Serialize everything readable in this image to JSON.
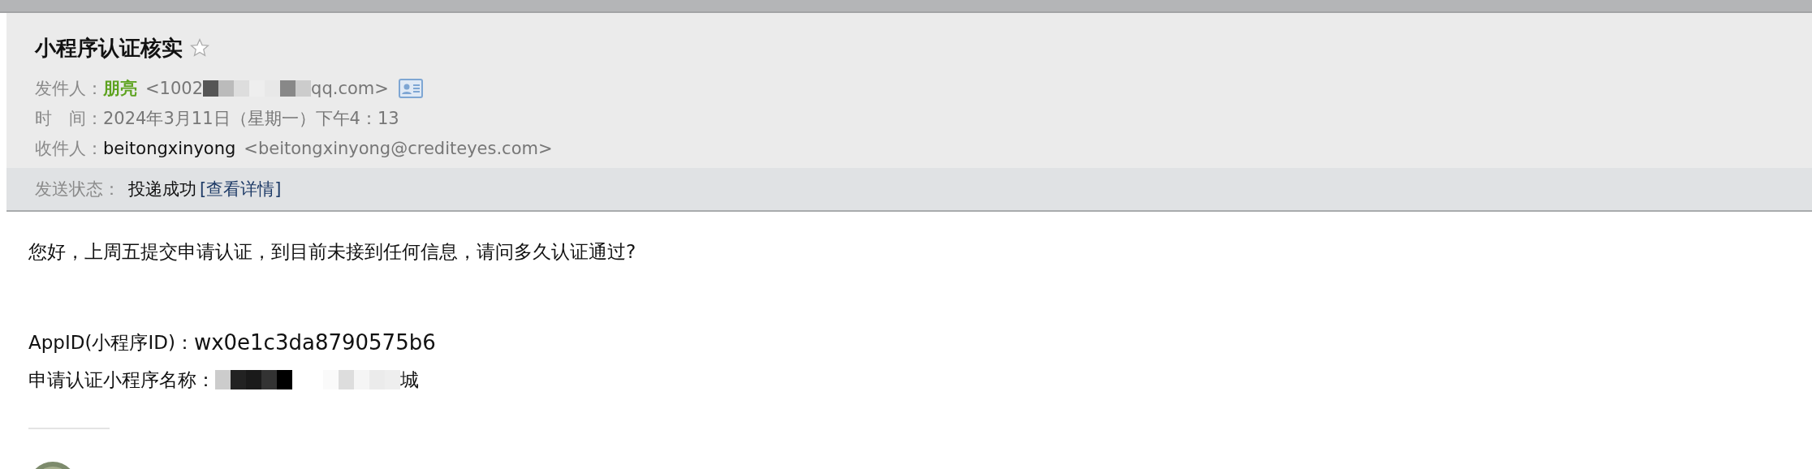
{
  "mail": {
    "subject": "小程序认证核实",
    "starred": false,
    "from": {
      "label": "发件人：",
      "name": "朋亮",
      "address_start": "<1002",
      "address_end": "qq.com>"
    },
    "time": {
      "label": "时　间：",
      "value": "2024年3月11日（星期一）下午4：13"
    },
    "to": {
      "label": "收件人：",
      "name": "beitongxinyong",
      "address": "<beitongxinyong@crediteyes.com>"
    },
    "status": {
      "label": "发送状态：",
      "value": "投递成功",
      "link": "[查看详情]"
    }
  },
  "body": {
    "greeting": "您好，上周五提交申请认证，到目前未接到任何信息，请问多久认证通过?",
    "appid_label": "AppID(小程序ID)：",
    "appid": "wx0e1c3da8790575b6",
    "name_label": "申请认证小程序名称：",
    "name_end": "城"
  }
}
